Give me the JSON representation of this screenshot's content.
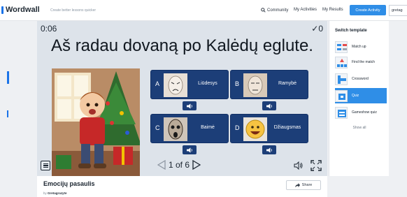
{
  "header": {
    "logo": "Wordwall",
    "tagline": "Create better lessons quicker",
    "nav": {
      "community": "Community",
      "my_activities": "My Activities",
      "my_results": "My Results"
    },
    "create_activity": "Create Activity",
    "user": "gretag"
  },
  "game": {
    "timer": "0:06",
    "score": "0",
    "question": "Aš radau dovaną po Kalėdų eglute.",
    "answers": [
      {
        "letter": "A",
        "label": "Liūdesys"
      },
      {
        "letter": "B",
        "label": "Ramybė"
      },
      {
        "letter": "C",
        "label": "Baimė"
      },
      {
        "letter": "D",
        "label": "Džiaugsmas"
      }
    ],
    "pager": "1 of 6"
  },
  "sidebar": {
    "title": "Switch template",
    "templates": [
      {
        "name": "Match up",
        "active": false
      },
      {
        "name": "Find the match",
        "active": false
      },
      {
        "name": "Crossword",
        "active": false
      },
      {
        "name": "Quiz",
        "active": true
      },
      {
        "name": "Gameshow quiz",
        "active": false
      }
    ],
    "show_all": "Show all"
  },
  "activity": {
    "title": "Emocijų pasaulis",
    "by": "by",
    "author": "Gretagrazyte",
    "share": "Share"
  },
  "colors": {
    "accent": "#2f8ee7",
    "answer_tile": "#1c3e78",
    "stage_bg": "#dde3ea"
  }
}
